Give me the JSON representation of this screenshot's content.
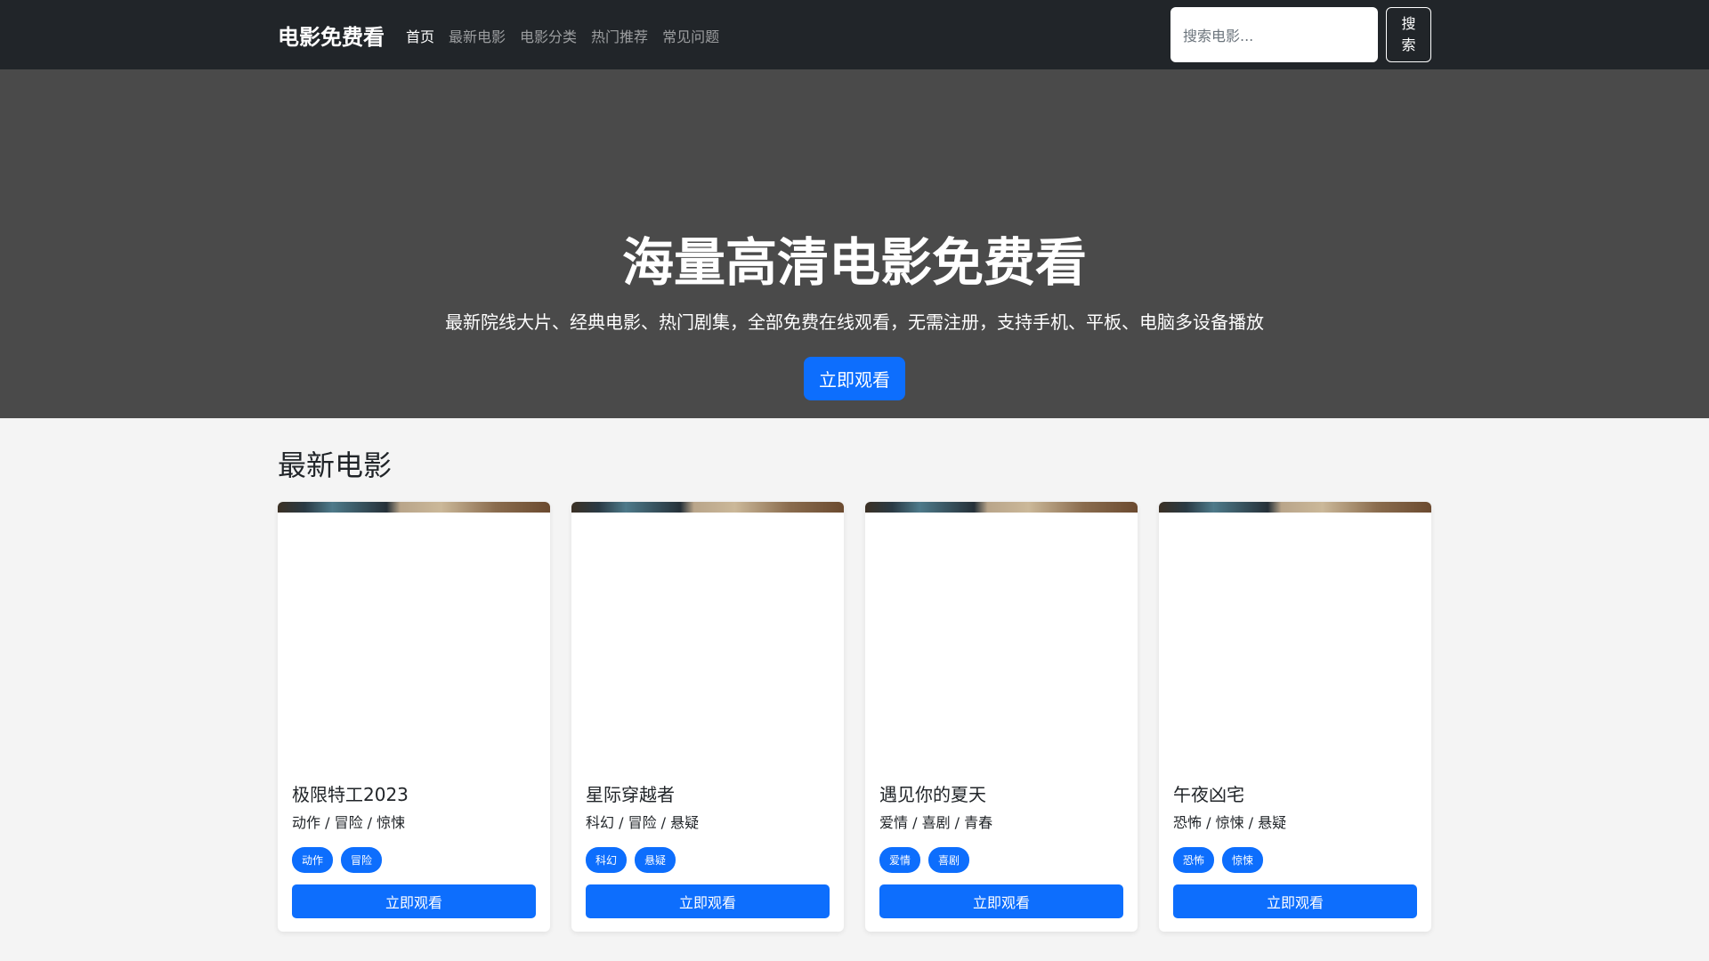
{
  "nav": {
    "brand": "电影免费看",
    "links": [
      "首页",
      "最新电影",
      "电影分类",
      "热门推荐",
      "常见问题"
    ],
    "search_placeholder": "搜索电影...",
    "search_button": "搜索"
  },
  "hero": {
    "title": "海量高清电影免费看",
    "subtitle": "最新院线大片、经典电影、热门剧集，全部免费在线观看，无需注册，支持手机、平板、电脑多设备播放",
    "cta": "立即观看"
  },
  "section": {
    "title": "最新电影"
  },
  "movies": [
    {
      "title": "极限特工2023",
      "genres": "动作 / 冒险 / 惊悚",
      "tags": [
        "动作",
        "冒险"
      ],
      "button": "立即观看"
    },
    {
      "title": "星际穿越者",
      "genres": "科幻 / 冒险 / 悬疑",
      "tags": [
        "科幻",
        "悬疑"
      ],
      "button": "立即观看"
    },
    {
      "title": "遇见你的夏天",
      "genres": "爱情 / 喜剧 / 青春",
      "tags": [
        "爱情",
        "喜剧"
      ],
      "button": "立即观看"
    },
    {
      "title": "午夜凶宅",
      "genres": "恐怖 / 惊悚 / 悬疑",
      "tags": [
        "恐怖",
        "惊悚"
      ],
      "button": "立即观看"
    }
  ]
}
